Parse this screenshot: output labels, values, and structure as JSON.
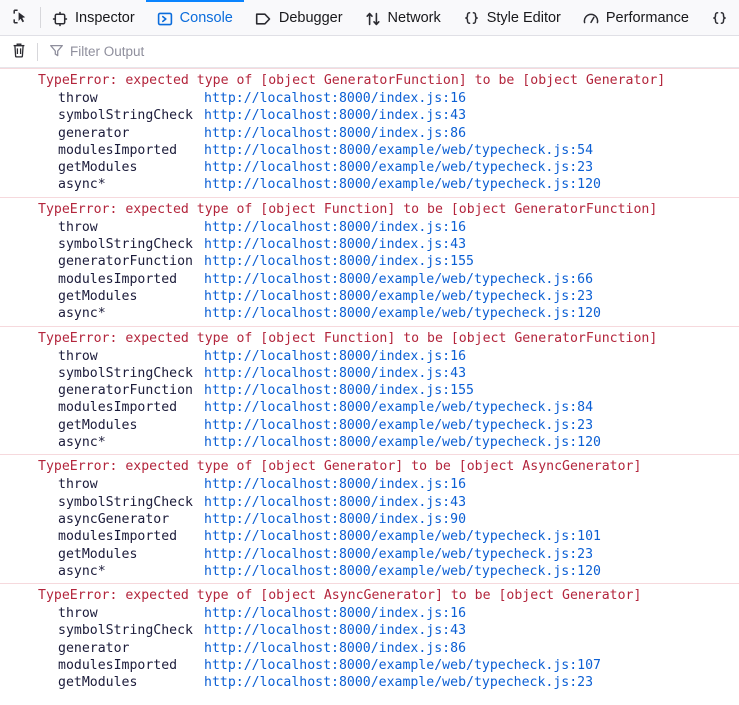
{
  "toolbar": {
    "picker_icon": "element-picker-icon",
    "tabs": [
      {
        "label": "Inspector",
        "icon": "inspector-target-icon",
        "selected": false
      },
      {
        "label": "Console",
        "icon": "console-prompt-icon",
        "selected": true
      },
      {
        "label": "Debugger",
        "icon": "debugger-tag-icon",
        "selected": false
      },
      {
        "label": "Network",
        "icon": "network-arrows-icon",
        "selected": false
      },
      {
        "label": "Style Editor",
        "icon": "style-editor-braces-icon",
        "selected": false
      },
      {
        "label": "Performance",
        "icon": "performance-gauge-icon",
        "selected": false
      },
      {
        "label": "",
        "icon": "memory-braces-icon",
        "selected": false
      }
    ]
  },
  "filterbar": {
    "clear_icon": "trash-icon",
    "filter_icon": "funnel-icon",
    "filter_placeholder": "Filter Output",
    "filter_value": ""
  },
  "colors": {
    "error_text": "#b3253c",
    "link": "#0b5fd4",
    "frame_function": "#1b1b3a",
    "selected_tab": "#0a6cdc",
    "tab_accent": "#0a84ff",
    "error_divider": "#f6d9dd"
  },
  "console": {
    "messages": [
      {
        "head": "TypeError: expected type of [object GeneratorFunction] to be [object Generator]",
        "frames": [
          {
            "fn": "throw",
            "link": "http://localhost:8000/index.js:16"
          },
          {
            "fn": "symbolStringCheck",
            "link": "http://localhost:8000/index.js:43"
          },
          {
            "fn": "generator",
            "link": "http://localhost:8000/index.js:86"
          },
          {
            "fn": "modulesImported",
            "link": "http://localhost:8000/example/web/typecheck.js:54"
          },
          {
            "fn": "getModules",
            "link": "http://localhost:8000/example/web/typecheck.js:23"
          },
          {
            "fn": "async*",
            "link": "http://localhost:8000/example/web/typecheck.js:120"
          }
        ]
      },
      {
        "head": "TypeError: expected type of [object Function] to be [object GeneratorFunction]",
        "frames": [
          {
            "fn": "throw",
            "link": "http://localhost:8000/index.js:16"
          },
          {
            "fn": "symbolStringCheck",
            "link": "http://localhost:8000/index.js:43"
          },
          {
            "fn": "generatorFunction",
            "link": "http://localhost:8000/index.js:155"
          },
          {
            "fn": "modulesImported",
            "link": "http://localhost:8000/example/web/typecheck.js:66"
          },
          {
            "fn": "getModules",
            "link": "http://localhost:8000/example/web/typecheck.js:23"
          },
          {
            "fn": "async*",
            "link": "http://localhost:8000/example/web/typecheck.js:120"
          }
        ]
      },
      {
        "head": "TypeError: expected type of [object Function] to be [object GeneratorFunction]",
        "frames": [
          {
            "fn": "throw",
            "link": "http://localhost:8000/index.js:16"
          },
          {
            "fn": "symbolStringCheck",
            "link": "http://localhost:8000/index.js:43"
          },
          {
            "fn": "generatorFunction",
            "link": "http://localhost:8000/index.js:155"
          },
          {
            "fn": "modulesImported",
            "link": "http://localhost:8000/example/web/typecheck.js:84"
          },
          {
            "fn": "getModules",
            "link": "http://localhost:8000/example/web/typecheck.js:23"
          },
          {
            "fn": "async*",
            "link": "http://localhost:8000/example/web/typecheck.js:120"
          }
        ]
      },
      {
        "head": "TypeError: expected type of [object Generator] to be [object AsyncGenerator]",
        "frames": [
          {
            "fn": "throw",
            "link": "http://localhost:8000/index.js:16"
          },
          {
            "fn": "symbolStringCheck",
            "link": "http://localhost:8000/index.js:43"
          },
          {
            "fn": "asyncGenerator",
            "link": "http://localhost:8000/index.js:90"
          },
          {
            "fn": "modulesImported",
            "link": "http://localhost:8000/example/web/typecheck.js:101"
          },
          {
            "fn": "getModules",
            "link": "http://localhost:8000/example/web/typecheck.js:23"
          },
          {
            "fn": "async*",
            "link": "http://localhost:8000/example/web/typecheck.js:120"
          }
        ]
      },
      {
        "head": "TypeError: expected type of [object AsyncGenerator] to be [object Generator]",
        "frames": [
          {
            "fn": "throw",
            "link": "http://localhost:8000/index.js:16"
          },
          {
            "fn": "symbolStringCheck",
            "link": "http://localhost:8000/index.js:43"
          },
          {
            "fn": "generator",
            "link": "http://localhost:8000/index.js:86"
          },
          {
            "fn": "modulesImported",
            "link": "http://localhost:8000/example/web/typecheck.js:107"
          },
          {
            "fn": "getModules",
            "link": "http://localhost:8000/example/web/typecheck.js:23"
          }
        ]
      }
    ]
  }
}
